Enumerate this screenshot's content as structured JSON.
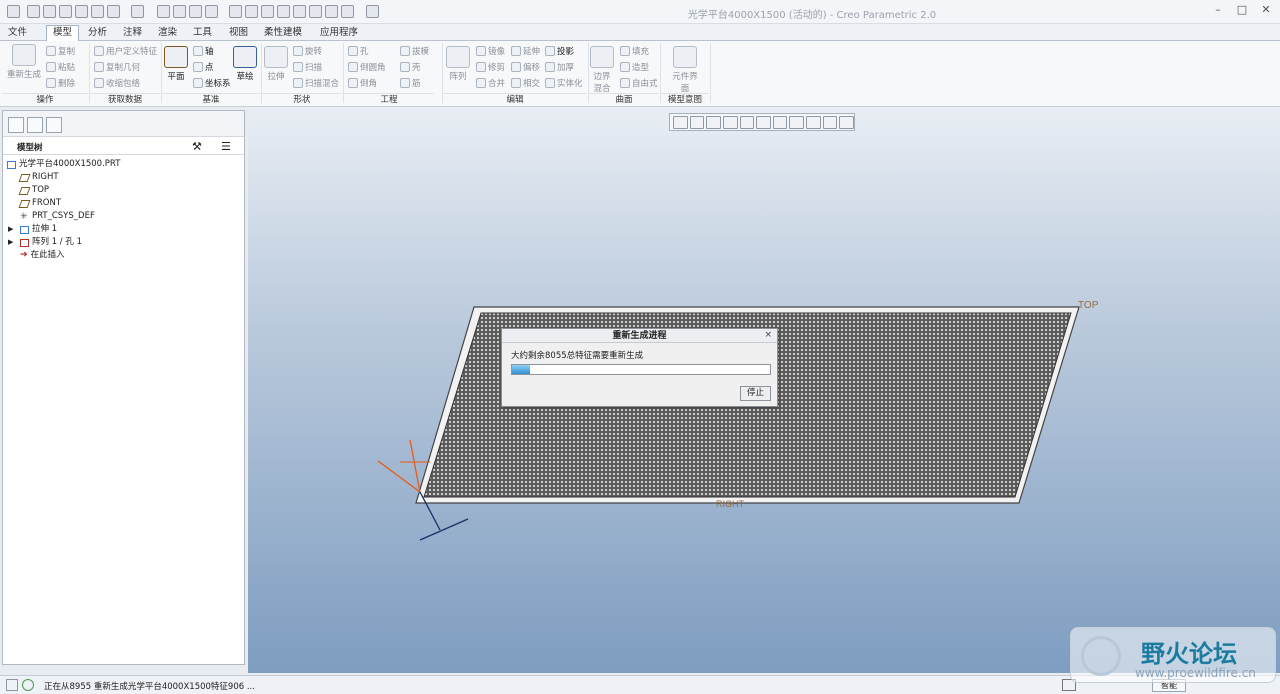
{
  "window": {
    "title": "光学平台4000X1500 (活动的) - Creo Parametric 2.0"
  },
  "tabs": [
    "文件",
    "模型",
    "分析",
    "注释",
    "渲染",
    "工具",
    "视图",
    "柔性建模",
    "应用程序"
  ],
  "ribbon": {
    "operations": {
      "regenerate": "重新生成",
      "copy": "复制",
      "paste": "粘贴",
      "delete": "删除",
      "group": "操作"
    },
    "get_data": {
      "udf": "用户定义特征",
      "copy_geom": "复制几何",
      "shrinkwrap": "收缩包络",
      "group": "获取数据"
    },
    "datum": {
      "plane": "平面",
      "axis": "轴",
      "point": "点",
      "csys": "坐标系",
      "sketch": "草绘",
      "group": "基准"
    },
    "shapes": {
      "extrude": "拉伸",
      "revolve": "旋转",
      "sweep": "扫描",
      "swept_blend": "扫描混合",
      "group": "形状"
    },
    "engineering": {
      "hole": "孔",
      "round": "倒圆角",
      "chamfer": "倒角",
      "draft": "拔模",
      "shell": "壳",
      "rib": "筋",
      "group": "工程"
    },
    "editing": {
      "pattern": "阵列",
      "mirror": "镜像",
      "trim": "修剪",
      "merge": "合并",
      "extend": "延伸",
      "offset": "偏移",
      "intersect": "相交",
      "project": "投影",
      "thicken": "加厚",
      "solidify": "实体化",
      "group": "编辑"
    },
    "surfaces": {
      "boundary": "边界混合",
      "fill": "填充",
      "style": "造型",
      "freestyle": "自由式",
      "group": "曲面"
    },
    "intent": {
      "component": "元件界面",
      "group": "模型意图"
    }
  },
  "tree": {
    "title": "模型树",
    "items": [
      "光学平台4000X1500.PRT",
      "RIGHT",
      "TOP",
      "FRONT",
      "PRT_CSYS_DEF",
      "拉伸 1",
      "阵列 1 / 孔 1",
      "在此插入"
    ]
  },
  "viewport": {
    "labels": {
      "top": "TOP",
      "right": "RIGHT"
    }
  },
  "dialog": {
    "title": "重新生成进程",
    "message": "大约剩余8055总特征需要重新生成",
    "progress": 0.07,
    "stop": "停止",
    "close": "×"
  },
  "status": {
    "text": "正在从8955 重新生成光学平台4000X1500特征906 ...",
    "mode": "智能"
  },
  "watermark": {
    "cn": "野火论坛",
    "url": "www.proewildfire.cn"
  }
}
